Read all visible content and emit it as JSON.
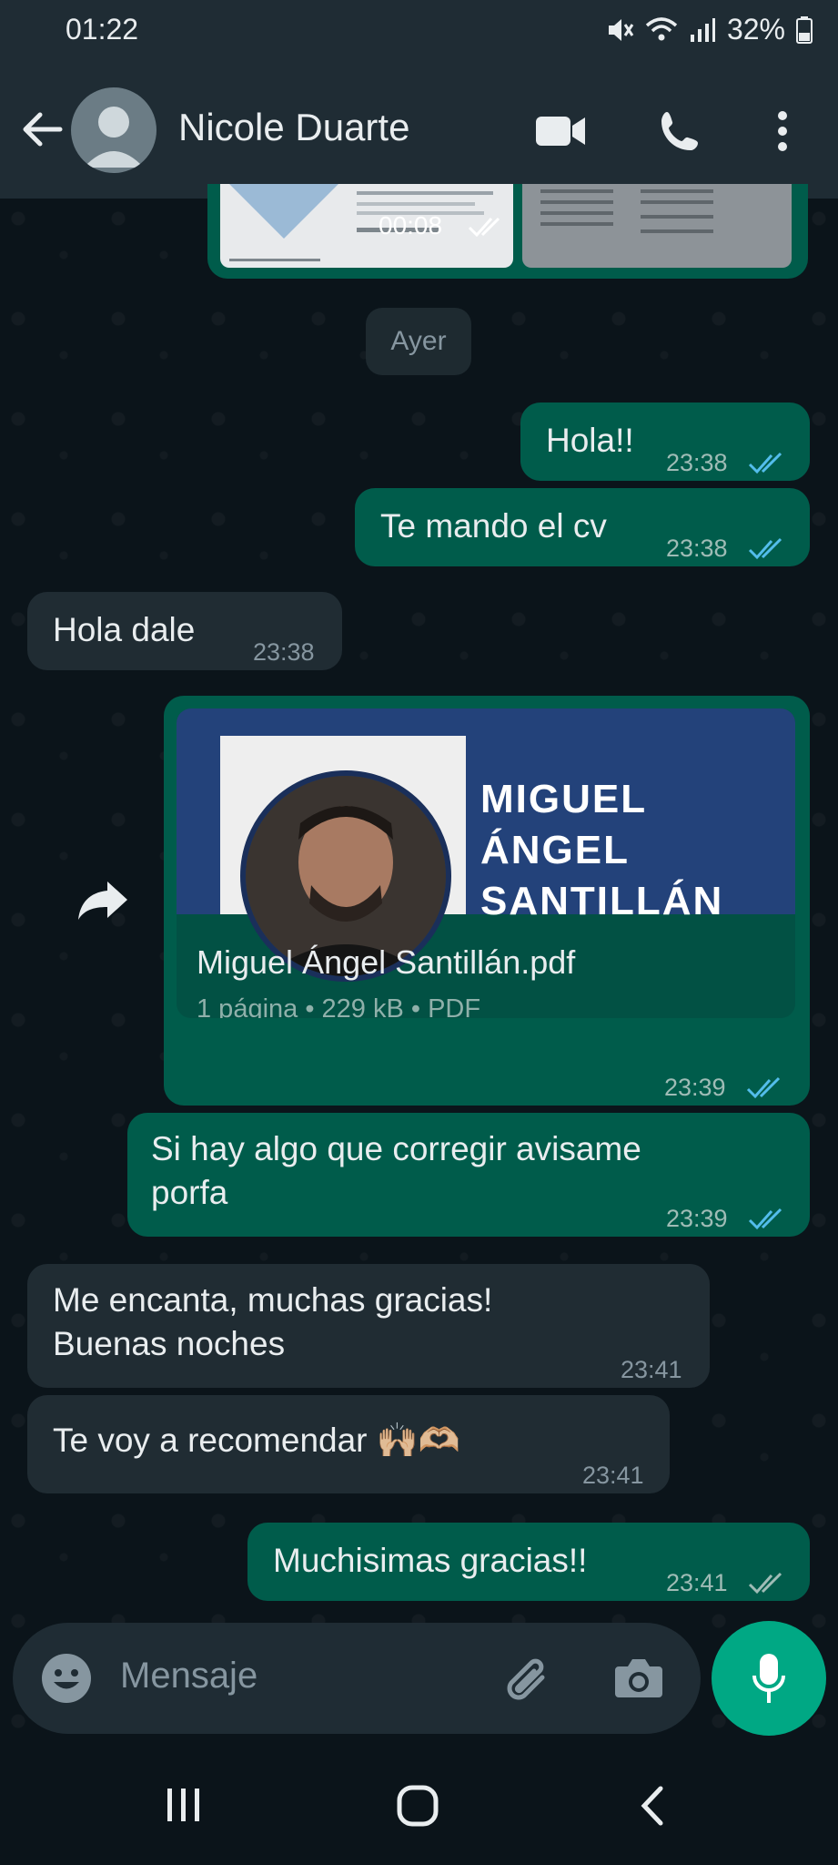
{
  "status_bar": {
    "time": "01:22",
    "battery": "32%"
  },
  "header": {
    "contact_name": "Nicole Duarte"
  },
  "media_preview": {
    "duration": "00:08"
  },
  "date_chip": "Ayer",
  "messages": [
    {
      "direction": "out",
      "text": "Hola!!",
      "time": "23:38",
      "read": true
    },
    {
      "direction": "out",
      "text": "Te mando el cv",
      "time": "23:38",
      "read": true
    },
    {
      "direction": "in",
      "text": "Hola dale",
      "time": "23:38"
    },
    {
      "direction": "out",
      "type": "document",
      "time": "23:39",
      "read": true
    },
    {
      "direction": "out",
      "text_line1": "Si hay algo que corregir avisame",
      "text_line2": "porfa",
      "time": "23:39",
      "read": true
    },
    {
      "direction": "in",
      "text_line1": "Me encanta, muchas gracias!",
      "text_line2": "Buenas noches",
      "time": "23:41"
    },
    {
      "direction": "in",
      "text": "Te voy a recomendar 🙌🏼🫶🏼",
      "time": "23:41"
    },
    {
      "direction": "out",
      "text": "Muchisimas gracias!!",
      "time": "23:41",
      "read": false
    }
  ],
  "document": {
    "thumb_heading_line1": "MIGUEL",
    "thumb_heading_line2": "ÁNGEL",
    "thumb_heading_line3": "SANTILLÁN",
    "file_name": "Miguel Ángel Santillán.pdf",
    "meta": "1 página • 229 kB • PDF"
  },
  "composer": {
    "placeholder": "Mensaje"
  },
  "colors": {
    "header_bg": "#1f2c34",
    "outgoing_bubble": "#005c4b",
    "incoming_bubble": "#202c33",
    "read_tick": "#53bdeb",
    "accent": "#00a884"
  },
  "icons": [
    "back-arrow-icon",
    "avatar-icon",
    "video-call-icon",
    "phone-icon",
    "more-vert-icon",
    "forward-icon",
    "emoji-icon",
    "attach-icon",
    "camera-icon",
    "mic-icon",
    "recent-apps-icon",
    "home-icon",
    "back-nav-icon"
  ]
}
